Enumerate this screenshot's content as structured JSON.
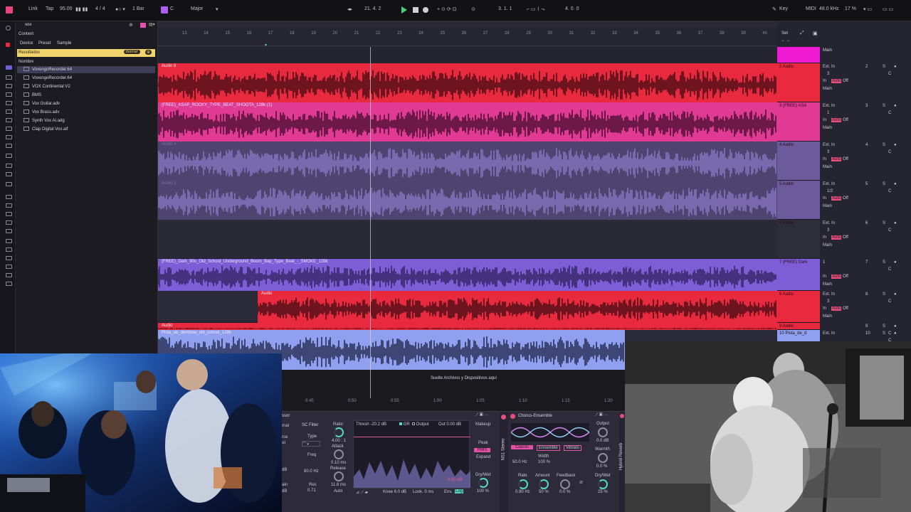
{
  "topbar": {
    "link": "Link",
    "tap": "Tap",
    "tempo": "95.00",
    "time_sig": "4 / 4",
    "metronome": "1 Bar",
    "key_root": "C",
    "key_scale": "Major",
    "position": "21.  4.  2",
    "loop_start": "3.  1.  1",
    "loop_length": "4.  0.  0",
    "key_label": "Key",
    "midi_label": "MIDI",
    "sample_rate": "48.0 kHz",
    "cpu": "17 %"
  },
  "browser": {
    "search_value": "vox",
    "tabs": {
      "content": "Content",
      "device": "Device",
      "preset": "Preset",
      "sample": "Sample"
    },
    "results_label": "Resultados",
    "clear_label": "Borrar",
    "column_header": "Nombre",
    "items": [
      "VoxengoRecorder.64",
      "VoxengoRecorder.64",
      "VOX Continental V2",
      "BMS",
      "Vox Guitar.adv",
      "Vox Brass.adv",
      "Synth Vox AI.adg",
      "Clap Digital Vox.aif"
    ]
  },
  "ruler": {
    "bars": [
      "13",
      "14",
      "15",
      "16",
      "17",
      "18",
      "19",
      "20",
      "21",
      "22",
      "23",
      "24",
      "25",
      "26",
      "27",
      "28",
      "29",
      "30",
      "31",
      "32",
      "33",
      "34",
      "35",
      "36",
      "37",
      "38",
      "39",
      "40"
    ],
    "set_label": "Set",
    "times": [
      "0:45",
      "0:50",
      "0:55",
      "1:00",
      "1:05",
      "1:10",
      "1:15",
      "1:20"
    ]
  },
  "tracks": [
    {
      "clip": "Audio 6",
      "header": "2 Audio",
      "in": "Ext. In",
      "ch": "3",
      "num": "2",
      "color": "#e8293e"
    },
    {
      "clip": "(FREE)_ASAP_ROCKY_TYPE_BEAT_SHOOTA_128k (1)",
      "header": "3 (FREE) ASA",
      "in": "Ext. In",
      "ch": "1",
      "num": "3",
      "color": "#e13a95"
    },
    {
      "clip": "Audio 4",
      "header": "4 Audio",
      "in": "Ext. In",
      "ch": "3",
      "num": "4",
      "color": "#6c5a9c"
    },
    {
      "clip": "Audio 3",
      "header": "5 Audio",
      "in": "Ext. In",
      "ch": "1/2",
      "num": "5",
      "color": "#6c5a9c"
    },
    {
      "clip": "",
      "header": "6 Audio",
      "in": "Ext. In",
      "ch": "3",
      "num": "6",
      "color": "#2e2d3a"
    },
    {
      "clip": "(FREE)_Dark_90s_Old_School_Underground_Boom_Bap_Type_Beat_-_SMOKE_128k",
      "header": "7 (FREE) Dark",
      "in": "1",
      "ch": "",
      "num": "7",
      "color": "#7d5ed6"
    },
    {
      "clip": "Audio",
      "header": "8 Audio",
      "in": "Ext. In",
      "ch": "3",
      "num": "8",
      "color": "#e8293e"
    },
    {
      "clip": "Audio",
      "header": "9 Audio",
      "in": "",
      "ch": "",
      "num": "9",
      "color": "#e8293e"
    },
    {
      "clip": "Pista_de_dembow_old_school_128k",
      "header": "10 Pista_de_d",
      "in": "Ext. In",
      "ch": "",
      "num": "10",
      "color": "#8fa0f0"
    }
  ],
  "mixer": {
    "main": "Main",
    "auto": "Auto",
    "off": "Off",
    "in": "In",
    "s": "S",
    "c": "C"
  },
  "drop_hint": "Suelte Archivos y Dispositivos aquí",
  "device_compressor": {
    "title": "ssor",
    "sc_filter": "SC Filter",
    "ratio_label": "Ratio",
    "ratio": "4.00 : 1",
    "attack_label": "Attack",
    "attack": "0.10 ms",
    "release_label": "Release",
    "release": "11.8 ms",
    "release_mode": "Auto",
    "type_label": "Type",
    "freq_label": "Freq",
    "freq": "80.0 Hz",
    "res_label": "Res",
    "res": "0.71",
    "thresh": "Thresh -20.2 dB",
    "gr": "GR",
    "output_toggle": "Output",
    "out": "Out 0.00 dB",
    "makeup": "Makeup",
    "peak": "Peak",
    "rms": "RMS",
    "expand": "Expand",
    "knee": "Knee 6.0 dB",
    "look": "Look. 0 ms",
    "env": "Env.",
    "drywet_label": "Dry/Wet",
    "drywet": "100 %",
    "ceiling": "-8.60 dB",
    "log": "Log",
    "side_labels": [
      "rnal",
      "rce",
      "ut",
      "dB",
      "ain",
      "dB"
    ],
    "ns1": "NS1 Stereo"
  },
  "device_chorus": {
    "title": "Chorus-Ensemble",
    "modes": [
      "Classic",
      "Ensemble",
      "Vibrato"
    ],
    "freq": "50.0 Hz",
    "width_label": "Width",
    "width": "100 %",
    "output_label": "Output",
    "output": "0.0 dB",
    "warmth_label": "Warmth",
    "warmth": "0.0 %",
    "rate_label": "Rate",
    "rate": "0.90 Hz",
    "amount_label": "Amount",
    "amount": "50 %",
    "feedback_label": "Feedback",
    "feedback": "0.0 %",
    "drywet_label": "Dry/Wet",
    "drywet": "25 %",
    "next": "Hybrid Reverb"
  }
}
